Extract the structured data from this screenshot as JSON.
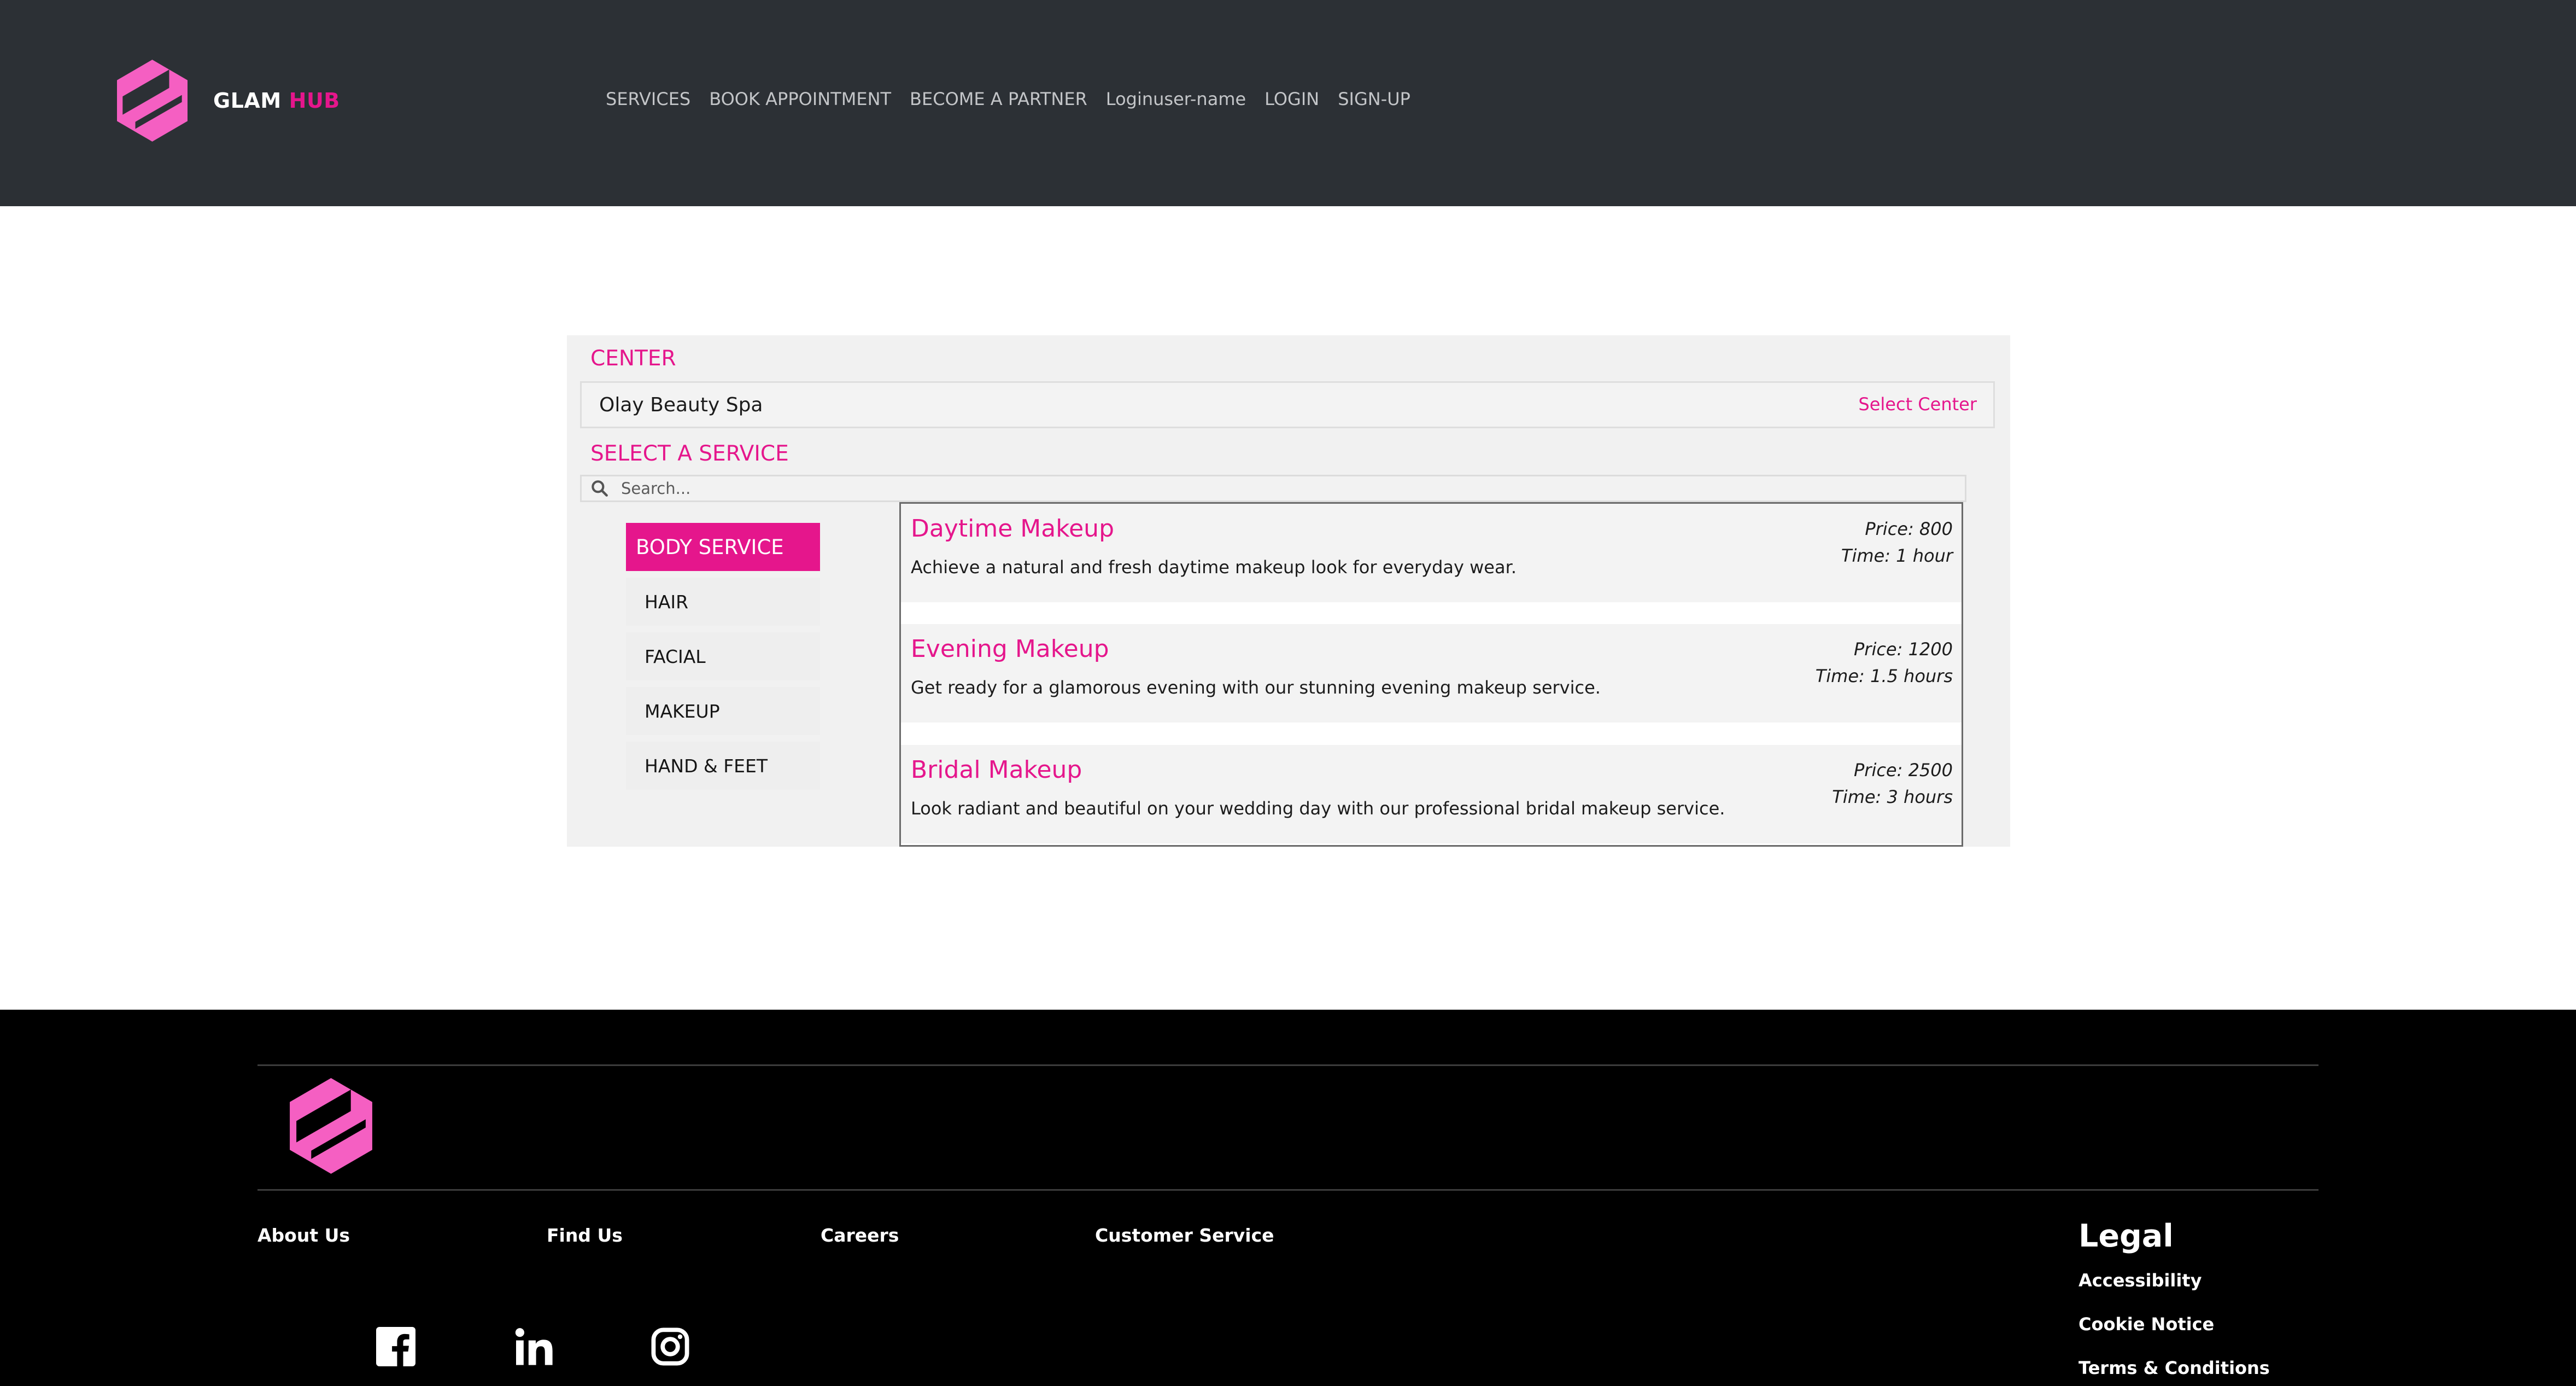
{
  "header": {
    "brand_primary": "GLAM",
    "brand_accent": "HUB",
    "nav": [
      "SERVICES",
      "BOOK APPOINTMENT",
      "BECOME A PARTNER",
      "Loginuser-name",
      "LOGIN",
      "SIGN-UP"
    ]
  },
  "center": {
    "title": "CENTER",
    "value": "Olay Beauty Spa",
    "select_label": "Select Center"
  },
  "service": {
    "title": "SELECT A SERVICE",
    "search_placeholder": "Search...",
    "categories": [
      "BODY SERVICE",
      "HAIR",
      "FACIAL",
      "MAKEUP",
      "HAND & FEET"
    ],
    "active_category": "BODY SERVICE",
    "items": [
      {
        "name": "Daytime Makeup",
        "description": "Achieve a natural and fresh daytime makeup look for everyday wear.",
        "price": "Price: 800",
        "time": "Time: 1 hour"
      },
      {
        "name": "Evening Makeup",
        "description": "Get ready for a glamorous evening with our stunning evening makeup service.",
        "price": "Price: 1200",
        "time": "Time: 1.5 hours"
      },
      {
        "name": "Bridal Makeup",
        "description": "Look radiant and beautiful on your wedding day with our professional bridal makeup service.",
        "price": "Price: 2500",
        "time": "Time: 3 hours"
      }
    ]
  },
  "footer": {
    "links": [
      "About Us",
      "Find Us",
      "Careers",
      "Customer Service"
    ],
    "legal": {
      "heading": "Legal",
      "links": [
        "Accessibility",
        "Cookie Notice",
        "Terms & Conditions"
      ]
    },
    "social": [
      "facebook-icon",
      "linkedin-icon",
      "instagram-icon"
    ]
  },
  "colors": {
    "accent": "#e5168c",
    "logo_pink": "#f55fc2",
    "header_bg": "#2c3035",
    "footer_bg": "#000000",
    "panel_bg": "#f1f1f1"
  }
}
